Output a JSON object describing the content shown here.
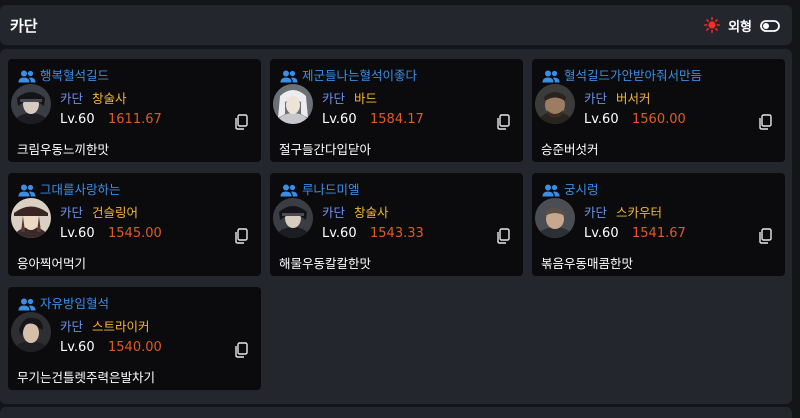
{
  "header": {
    "title": "카단",
    "appearance_label": "외형",
    "icons": {
      "sun": "sun-icon",
      "toggle": "toggle-switch-icon"
    },
    "colors": {
      "sun": "#ff2a2a"
    }
  },
  "cards": [
    {
      "guild": "행복혈석길드",
      "server": "카단",
      "class": "창술사",
      "level": "Lv.60",
      "item_level": "1611.67",
      "character": "크림우동느끼한맛",
      "avatar": "lancemaster-portrait"
    },
    {
      "guild": "제군들나는혈석이좋다",
      "server": "카단",
      "class": "바드",
      "level": "Lv.60",
      "item_level": "1584.17",
      "character": "절구들간다입닫아",
      "avatar": "bard-portrait"
    },
    {
      "guild": "혈석길드가안받아줘서만듬",
      "server": "카단",
      "class": "버서커",
      "level": "Lv.60",
      "item_level": "1560.00",
      "character": "승준버섯커",
      "avatar": "berserker-portrait"
    },
    {
      "guild": "그대를사랑하는",
      "server": "카단",
      "class": "건슬링어",
      "level": "Lv.60",
      "item_level": "1545.00",
      "character": "응아찍어먹기",
      "avatar": "gunslinger-portrait"
    },
    {
      "guild": "루나드미엘",
      "server": "카단",
      "class": "창술사",
      "level": "Lv.60",
      "item_level": "1543.33",
      "character": "해물우동칼칼한맛",
      "avatar": "lancemaster-portrait"
    },
    {
      "guild": "궁시렁",
      "server": "카단",
      "class": "스카우터",
      "level": "Lv.60",
      "item_level": "1541.67",
      "character": "볶음우동매콤한맛",
      "avatar": "scouter-portrait"
    },
    {
      "guild": "자유방임혈석",
      "server": "카단",
      "class": "스트라이커",
      "level": "Lv.60",
      "item_level": "1540.00",
      "character": "무기는건틀렛주력은발차기",
      "avatar": "striker-portrait"
    }
  ],
  "colors": {
    "guild": "#3b8ee6",
    "server": "#6f8fe8",
    "class": "#f0b536",
    "item_level": "#e05a28",
    "card_bg": "#0b0b0d",
    "panel_bg": "#24262e"
  }
}
